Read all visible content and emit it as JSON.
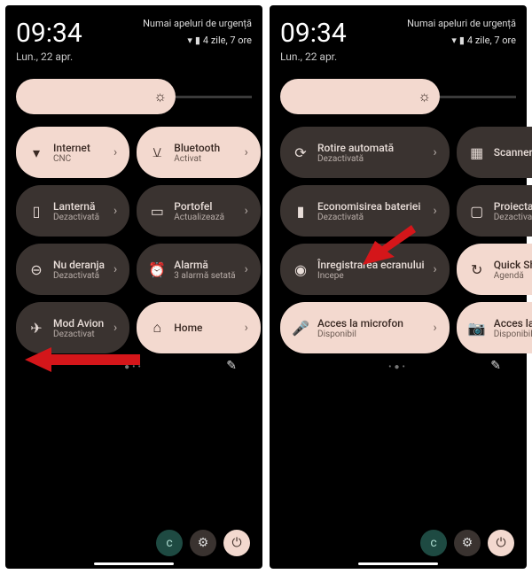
{
  "status": {
    "time": "09:34",
    "date": "Lun., 22 apr.",
    "emergency": "Numai apeluri de urgență",
    "battery": "4 zile, 7 ore"
  },
  "p1": {
    "page_indicator": "●••",
    "tiles": [
      {
        "name": "internet",
        "state": "on",
        "icon": "wifi",
        "title": "Internet",
        "sub": "CNC"
      },
      {
        "name": "bluetooth",
        "state": "on",
        "icon": "bt",
        "title": "Bluetooth",
        "sub": "Activat"
      },
      {
        "name": "lantern",
        "state": "off",
        "icon": "flash",
        "title": "Lanternă",
        "sub": "Dezactivată"
      },
      {
        "name": "wallet",
        "state": "off",
        "icon": "wallet",
        "title": "Portofel",
        "sub": "Actualizează"
      },
      {
        "name": "dnd",
        "state": "off",
        "icon": "dnd",
        "title": "Nu deranja",
        "sub": "Dezactivată"
      },
      {
        "name": "alarm",
        "state": "off",
        "icon": "alarm",
        "title": "Alarmă",
        "sub": "3 alarmă setată"
      },
      {
        "name": "airplane",
        "state": "off",
        "icon": "plane",
        "title": "Mod Avion",
        "sub": "Dezactivat"
      },
      {
        "name": "home",
        "state": "on",
        "icon": "home",
        "title": "Home",
        "sub": ""
      }
    ]
  },
  "p2": {
    "page_indicator": "•●•",
    "tiles": [
      {
        "name": "rotate",
        "state": "off",
        "icon": "rotate",
        "title": "Rotire automată",
        "sub": "Dezactivată"
      },
      {
        "name": "scanner",
        "state": "off",
        "icon": "qr",
        "title": "Scanner de coduri",
        "sub": ""
      },
      {
        "name": "battery",
        "state": "off",
        "icon": "batt",
        "title": "Economisirea bateriei",
        "sub": "Dezactivată"
      },
      {
        "name": "cast",
        "state": "off",
        "icon": "cast",
        "title": "Proiectarea ecranului",
        "sub": "Dezactivată"
      },
      {
        "name": "record",
        "state": "off",
        "icon": "record",
        "title": "Înregistrarea ecranului",
        "sub": "Începe"
      },
      {
        "name": "quickshare",
        "state": "on",
        "icon": "share",
        "title": "Quick Share",
        "sub": "Agendă"
      },
      {
        "name": "mic",
        "state": "on",
        "icon": "mic",
        "title": "Acces la microfon",
        "sub": "Disponibil"
      },
      {
        "name": "camera",
        "state": "on",
        "icon": "cam",
        "title": "Acces la cameră",
        "sub": "Disponibil"
      }
    ]
  },
  "icons": {
    "wifi": "▾",
    "bt": "⚺",
    "flash": "▯",
    "wallet": "▭",
    "dnd": "⊖",
    "alarm": "⏰",
    "plane": "✈",
    "home": "⌂",
    "rotate": "⟳",
    "qr": "▦",
    "batt": "▮",
    "cast": "▢",
    "record": "◉",
    "share": "↻",
    "mic": "🎤",
    "cam": "📷",
    "brightness": "☼",
    "edit": "✎",
    "user": "c",
    "gear": "⚙",
    "power": "⏻"
  }
}
